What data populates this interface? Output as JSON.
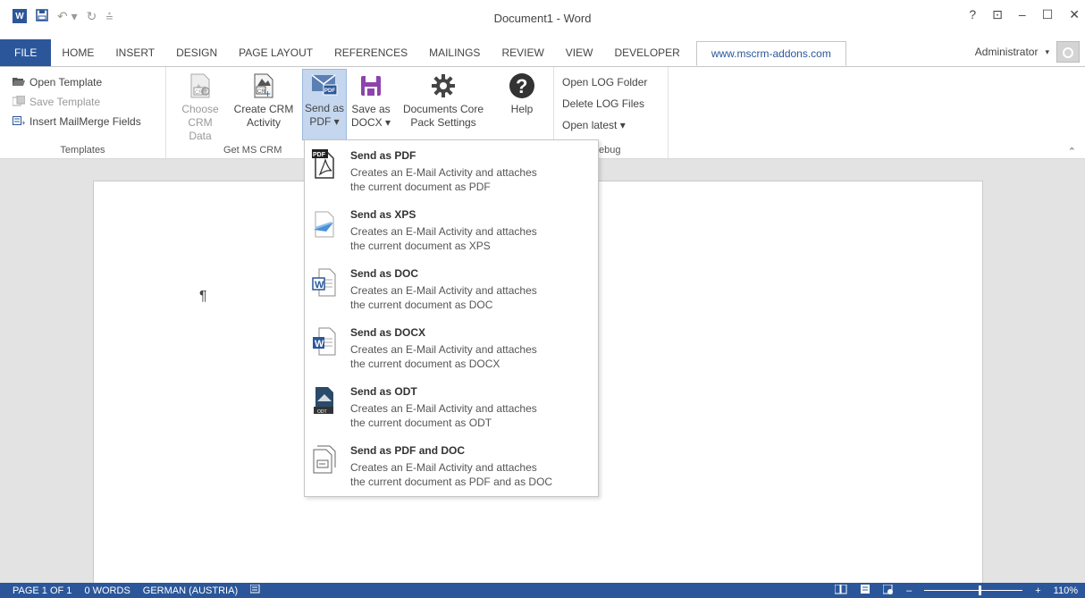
{
  "title_bar": {
    "document_title": "Document1 - Word",
    "app_logo_text": "W",
    "window_controls": [
      "?",
      "⊡",
      "–",
      "☐",
      "✕"
    ]
  },
  "tabs": [
    {
      "label": "FILE"
    },
    {
      "label": "HOME"
    },
    {
      "label": "INSERT"
    },
    {
      "label": "DESIGN"
    },
    {
      "label": "PAGE LAYOUT"
    },
    {
      "label": "REFERENCES"
    },
    {
      "label": "MAILINGS"
    },
    {
      "label": "REVIEW"
    },
    {
      "label": "VIEW"
    },
    {
      "label": "DEVELOPER"
    },
    {
      "label": "www.mscrm-addons.com"
    }
  ],
  "account": {
    "name": "Administrator"
  },
  "ribbon": {
    "templates_group": {
      "label": "Templates",
      "open_template": "Open Template",
      "save_template": "Save Template",
      "insert_mailmerge": "Insert MailMerge Fields"
    },
    "crm_group": {
      "label": "Get MS CRM",
      "choose_crm_line1": "Choose",
      "choose_crm_line2": "CRM Data",
      "create_crm_line1": "Create CRM",
      "create_crm_line2": "Activity",
      "send_pdf_line1": "Send as",
      "send_pdf_line2": "PDF ▾",
      "save_docx_line1": "Save as",
      "save_docx_line2": "DOCX ▾",
      "settings_line1": "Documents Core",
      "settings_line2": "Pack Settings",
      "help": "Help"
    },
    "debug_group": {
      "label": "ebug",
      "open_log": "Open LOG Folder",
      "delete_log": "Delete LOG Files",
      "open_latest": "Open latest ▾"
    }
  },
  "dropdown": {
    "items": [
      {
        "title": "Send as PDF",
        "line1": "Creates an E-Mail Activity and attaches",
        "line2": "the current document as PDF"
      },
      {
        "title": "Send as XPS",
        "line1": "Creates an E-Mail Activity and attaches",
        "line2": "the current document as XPS"
      },
      {
        "title": "Send as DOC",
        "line1": "Creates an E-Mail Activity and attaches",
        "line2": "the current document as DOC"
      },
      {
        "title": "Send as DOCX",
        "line1": "Creates an E-Mail Activity and attaches",
        "line2": "the current document as DOCX"
      },
      {
        "title": "Send as ODT",
        "line1": "Creates an E-Mail Activity and attaches",
        "line2": "the current document as ODT"
      },
      {
        "title": "Send as PDF and DOC",
        "line1": "Creates an E-Mail Activity and attaches",
        "line2": "the current document as PDF and as DOC"
      }
    ]
  },
  "document": {
    "pilcrow": "¶"
  },
  "status_bar": {
    "page": "PAGE 1 OF 1",
    "words": "0 WORDS",
    "language": "GERMAN (AUSTRIA)",
    "zoom": "110%",
    "zoom_level": 0.55
  },
  "colors": {
    "accent": "#2b579a",
    "selected": "#c5d7ee"
  }
}
